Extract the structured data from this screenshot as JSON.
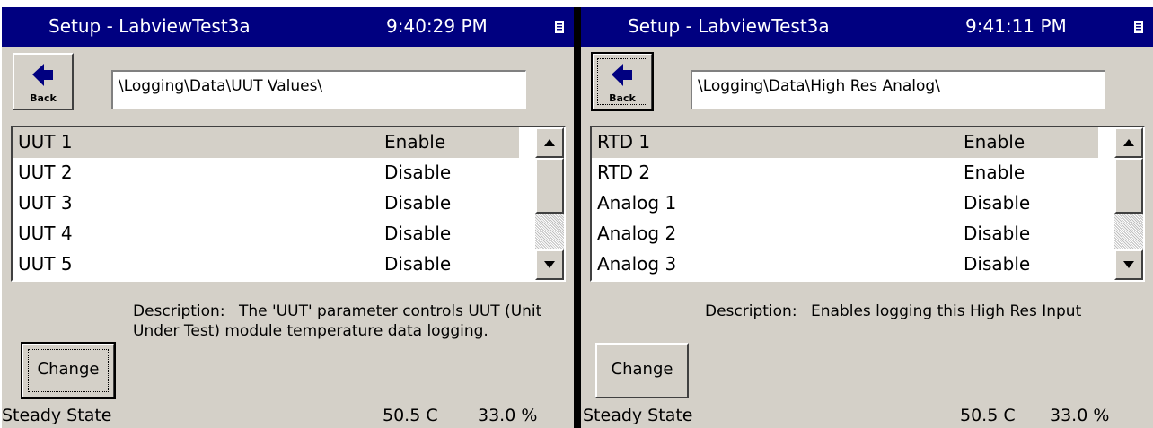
{
  "panels": [
    {
      "title": "Setup - LabviewTest3a",
      "time": "9:40:29 PM",
      "back_label": "Back",
      "path": "\\Logging\\Data\\UUT Values\\",
      "rows": [
        {
          "name": "UUT 1",
          "value": "Enable"
        },
        {
          "name": "UUT 2",
          "value": "Disable"
        },
        {
          "name": "UUT 3",
          "value": "Disable"
        },
        {
          "name": "UUT 4",
          "value": "Disable"
        },
        {
          "name": "UUT 5",
          "value": "Disable"
        }
      ],
      "selected_row": 0,
      "description_label": "Description:",
      "description": "The 'UUT' parameter controls UUT (Unit Under Test) module temperature data logging.",
      "change_label": "Change",
      "status_state": "Steady State",
      "status_temp": "50.5 C",
      "status_percent": "33.0 %"
    },
    {
      "title": "Setup - LabviewTest3a",
      "time": "9:41:11 PM",
      "back_label": "Back",
      "path": "\\Logging\\Data\\High Res Analog\\",
      "rows": [
        {
          "name": "RTD 1",
          "value": "Enable"
        },
        {
          "name": "RTD 2",
          "value": "Enable"
        },
        {
          "name": "Analog 1",
          "value": "Disable"
        },
        {
          "name": "Analog 2",
          "value": "Disable"
        },
        {
          "name": "Analog 3",
          "value": "Disable"
        }
      ],
      "selected_row": 0,
      "description_label": "Description:",
      "description": "Enables logging this High Res Input",
      "change_label": "Change",
      "status_state": "Steady State",
      "status_temp": "50.5 C",
      "status_percent": "33.0 %"
    }
  ],
  "colors": {
    "titlebar": "#000080",
    "panel_bg": "#d4d0c8",
    "selected_row": "#d4d0c8"
  },
  "icons": [
    "left-arrow-icon",
    "scroll-up-icon",
    "scroll-down-icon",
    "sip-icon"
  ]
}
